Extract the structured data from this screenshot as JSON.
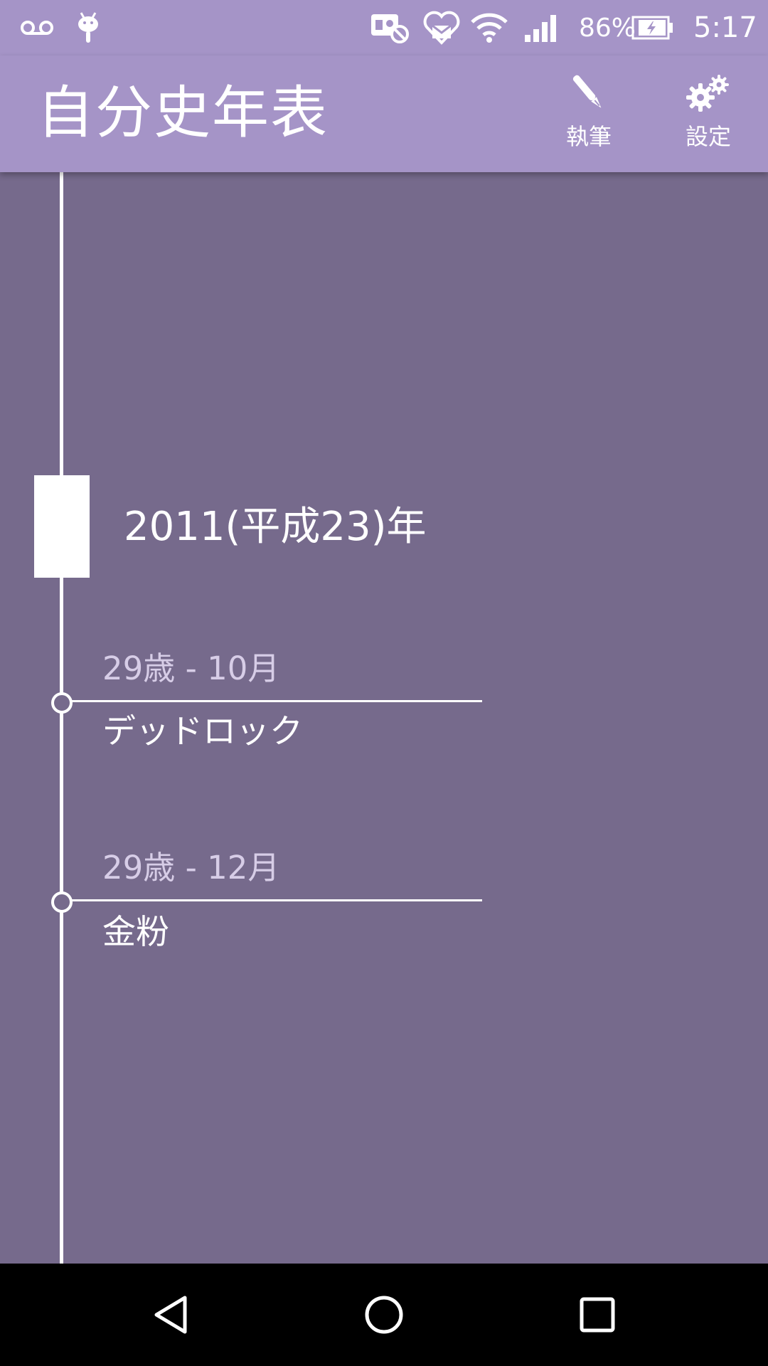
{
  "status_bar": {
    "icons": [
      "voicemail-icon",
      "android-icon",
      "no-sim-icon",
      "heart-mail-icon",
      "wifi-icon",
      "signal-icon",
      "battery-charging-icon"
    ],
    "battery_percent": "86%",
    "time": "5:17"
  },
  "app_bar": {
    "title": "自分史年表",
    "actions": [
      {
        "label": "執筆",
        "icon": "pen-icon"
      },
      {
        "label": "設定",
        "icon": "gears-icon"
      }
    ]
  },
  "timeline": {
    "year_label": "2011(平成23)年",
    "events": [
      {
        "date": "29歳 - 10月",
        "title": "デッドロック"
      },
      {
        "date": "29歳 - 12月",
        "title": "金粉"
      }
    ]
  },
  "nav_bar": {
    "buttons": [
      "back-icon",
      "home-icon",
      "recents-icon"
    ]
  },
  "colors": {
    "primary": "#a594c7",
    "background": "#766a8c",
    "date_text": "#d7cde7"
  }
}
